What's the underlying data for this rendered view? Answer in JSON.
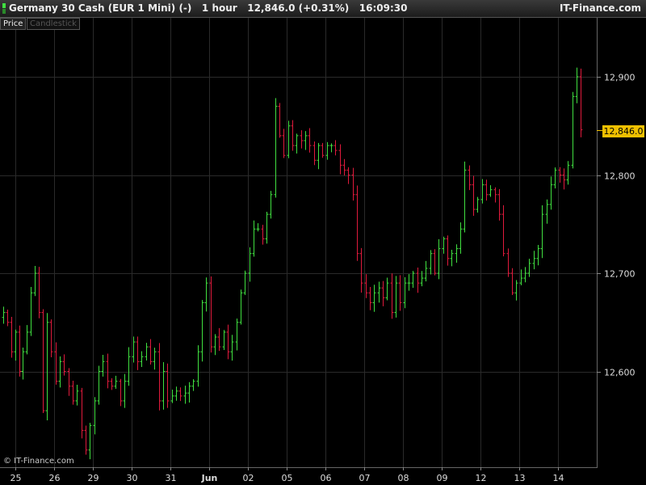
{
  "header": {
    "title": "Germany 30 Cash (EUR 1 Mini) (-)   1 hour   12,846.0 (+0.31%)   16:09:30",
    "brand": "IT-Finance.com"
  },
  "tabs": [
    {
      "label": "Price",
      "active": true
    },
    {
      "label": "Candlestick",
      "active": false
    }
  ],
  "copyright": "© IT-Finance.com",
  "current_price": "12,846.0",
  "colors": {
    "up": "#40e040",
    "down": "#e01a3c",
    "badge": "#f0c000",
    "grid": "#2a2a2a"
  },
  "chart_data": {
    "type": "bar",
    "style": "ohlc",
    "interval": "1 hour",
    "ylim": [
      12460,
      12930
    ],
    "y_ticks": [
      12600,
      12700,
      12800,
      12900
    ],
    "y_tick_labels": [
      "12,600",
      "12,700",
      "12,800",
      "12,900"
    ],
    "last_value": 12846.0,
    "grid": true,
    "days": [
      {
        "label": "25",
        "points": [
          12660,
          12650,
          12620,
          12640,
          12600,
          12620,
          12640,
          12680,
          12700,
          12660
        ]
      },
      {
        "label": "26",
        "points": [
          12560,
          12650,
          12620,
          12590,
          12610,
          12600,
          12585,
          12570,
          12580
        ]
      },
      {
        "label": "29",
        "points": [
          12540,
          12520,
          12545,
          12570,
          12600,
          12610,
          12590,
          12585,
          12590
        ]
      },
      {
        "label": "30",
        "points": [
          12570,
          12590,
          12615,
          12630,
          12610,
          12615,
          12625,
          12610,
          12620
        ]
      },
      {
        "label": "31",
        "points": [
          12570,
          12600,
          12570,
          12575,
          12580,
          12575,
          12578,
          12585,
          12590
        ]
      },
      {
        "label": "Jun",
        "points": [
          12620,
          12670,
          12690,
          12625,
          12635,
          12625,
          12640,
          12620,
          12630
        ]
      },
      {
        "label": "02",
        "points": [
          12650,
          12680,
          12700,
          12720,
          12745,
          12745,
          12735,
          12760,
          12780
        ]
      },
      {
        "label": "05",
        "points": [
          12870,
          12840,
          12820,
          12850,
          12830,
          12840,
          12835,
          12840,
          12830
        ]
      },
      {
        "label": "06",
        "points": [
          12815,
          12830,
          12820,
          12830,
          12830,
          12825,
          12810,
          12805,
          12800
        ]
      },
      {
        "label": "07",
        "points": [
          12780,
          12720,
          12690,
          12680,
          12670,
          12680,
          12685,
          12675,
          12690
        ]
      },
      {
        "label": "08",
        "points": [
          12660,
          12690,
          12670,
          12690,
          12690,
          12700,
          12690,
          12695,
          12705
        ]
      },
      {
        "label": "09",
        "points": [
          12720,
          12700,
          12725,
          12735,
          12715,
          12720,
          12725,
          12745,
          12805
        ]
      },
      {
        "label": "12",
        "points": [
          12790,
          12765,
          12775,
          12790,
          12780,
          12785,
          12780,
          12760,
          12720
        ]
      },
      {
        "label": "13",
        "points": [
          12700,
          12680,
          12690,
          12695,
          12700,
          12710,
          12715,
          12725,
          12760
        ]
      },
      {
        "label": "14",
        "points": [
          12770,
          12790,
          12805,
          12800,
          12795,
          12810,
          12880,
          12900,
          12846
        ]
      }
    ]
  }
}
